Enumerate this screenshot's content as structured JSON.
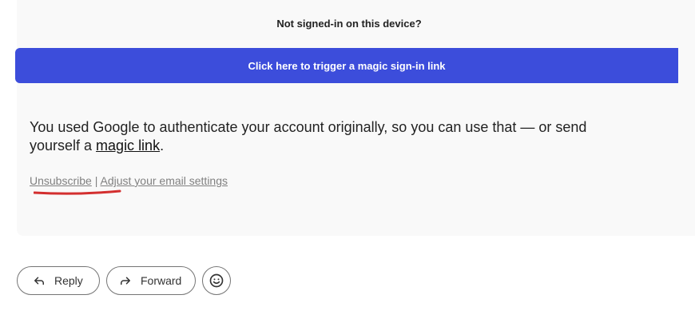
{
  "email": {
    "signed_in_question": "Not signed-in on this device?",
    "magic_button_label": "Click here to trigger a magic sign-in link",
    "body_text_before": "You used Google to authenticate your account originally, so you can use that — or send yourself a ",
    "magic_link_label": "magic link",
    "body_text_after": ".",
    "unsubscribe_label": "Unsubscribe",
    "separator": "|",
    "settings_label": "Adjust your email settings"
  },
  "actions": {
    "reply_label": "Reply",
    "forward_label": "Forward",
    "emoji_icon": "smiley-icon"
  },
  "colors": {
    "accent": "#3c4ddb",
    "annotation": "#d32f2f",
    "card_background": "#f9f9f9"
  }
}
